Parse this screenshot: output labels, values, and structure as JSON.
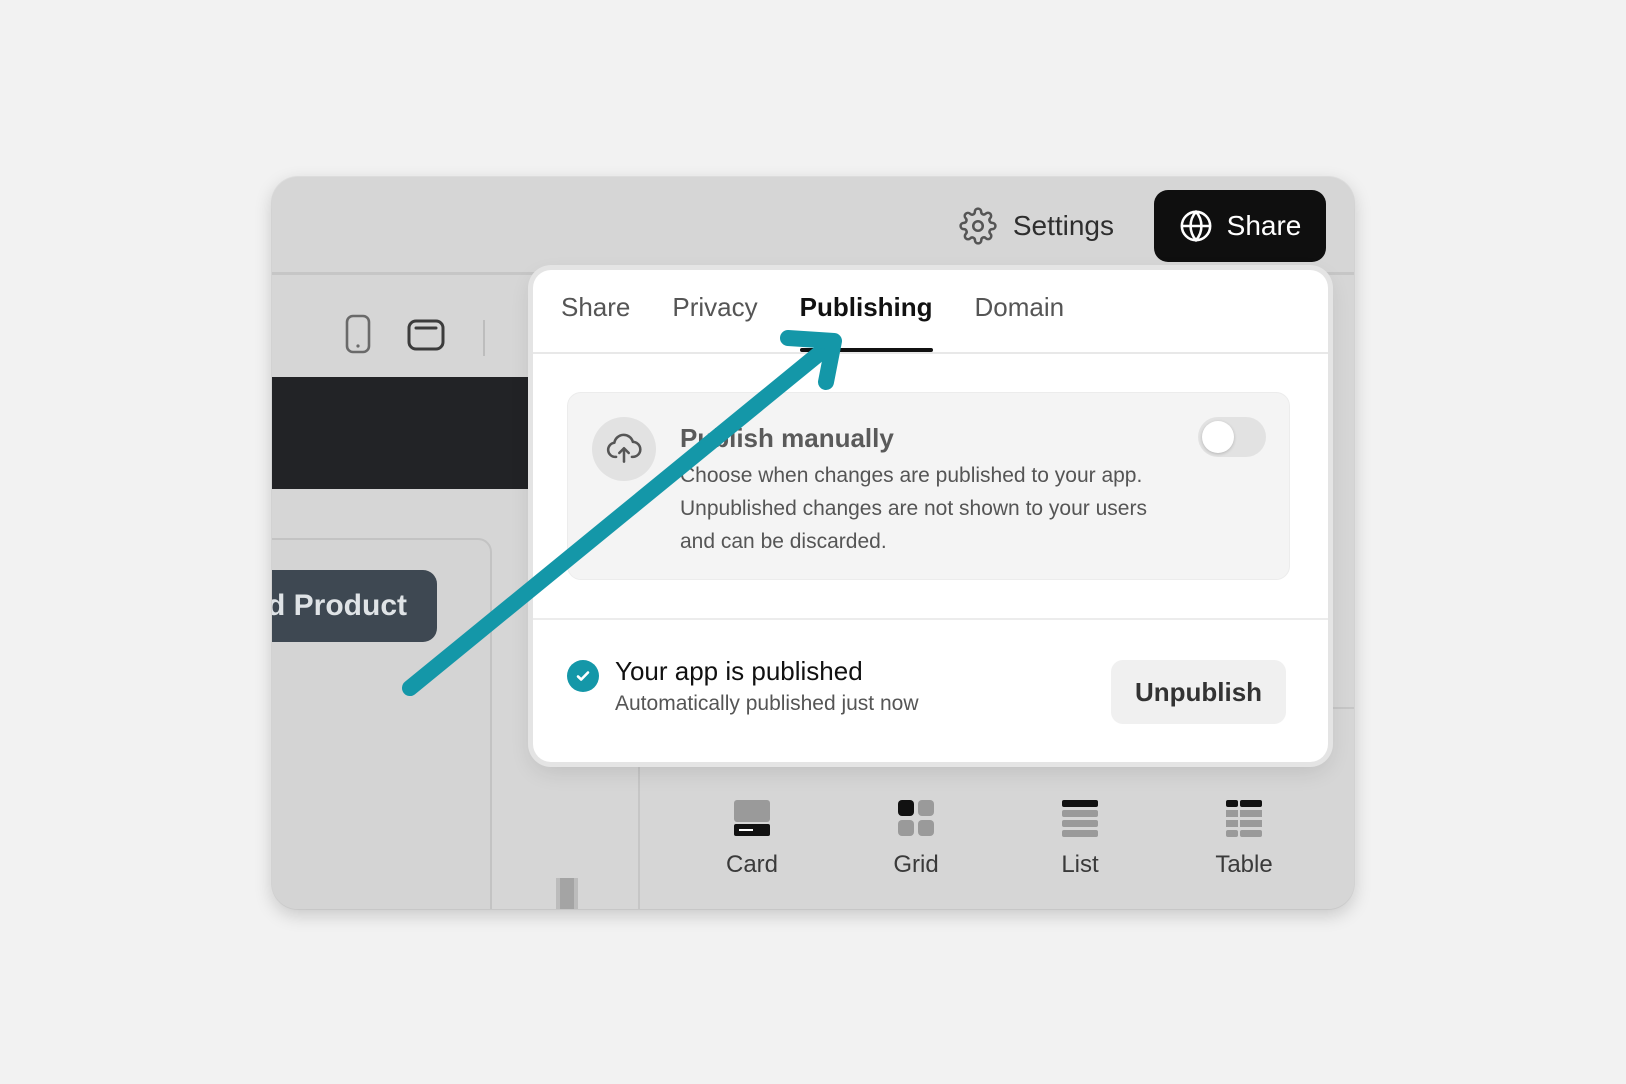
{
  "header": {
    "settings_label": "Settings",
    "share_label": "Share"
  },
  "canvas": {
    "add_product_label": "d Product"
  },
  "popover": {
    "tabs": [
      {
        "label": "Share"
      },
      {
        "label": "Privacy"
      },
      {
        "label": "Publishing"
      },
      {
        "label": "Domain"
      }
    ],
    "active_tab": "Publishing",
    "publish_manually": {
      "title": "Publish manually",
      "description": "Choose when changes are published to your app. Unpublished changes are not shown to your users and can be discarded.",
      "enabled": false
    },
    "status": {
      "title": "Your app is published",
      "subtitle": "Automatically published just now",
      "unpublish_label": "Unpublish"
    }
  },
  "layout_options": [
    {
      "label": "Card"
    },
    {
      "label": "Grid"
    },
    {
      "label": "List"
    },
    {
      "label": "Table"
    }
  ],
  "colors": {
    "accent": "#1497a8",
    "share_button": "#0f0f0f",
    "add_product_button": "#3e4852"
  }
}
